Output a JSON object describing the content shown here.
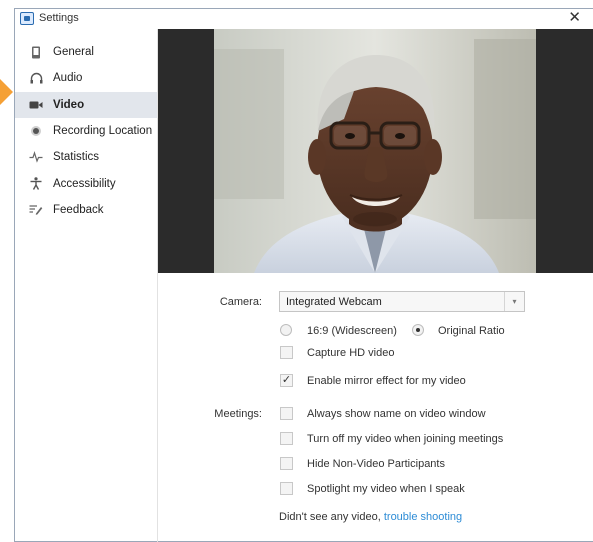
{
  "window": {
    "title": "Settings",
    "close_glyph": "✕"
  },
  "sidebar": {
    "items": [
      {
        "label": "General",
        "icon": "phone-icon"
      },
      {
        "label": "Audio",
        "icon": "headphones-icon"
      },
      {
        "label": "Video",
        "icon": "video-camera-icon",
        "active": true
      },
      {
        "label": "Recording Location",
        "icon": "record-dot-icon"
      },
      {
        "label": "Statistics",
        "icon": "statistics-icon"
      },
      {
        "label": "Accessibility",
        "icon": "accessibility-icon"
      },
      {
        "label": "Feedback",
        "icon": "feedback-icon"
      }
    ]
  },
  "video": {
    "camera_label": "Camera:",
    "camera_value": "Integrated Webcam",
    "aspect": {
      "option1": "16:9 (Widescreen)",
      "option2": "Original Ratio",
      "selected": "Original Ratio"
    },
    "hd_label": "Capture HD video",
    "hd_checked": false,
    "mirror_label": "Enable mirror effect for my video",
    "mirror_checked": true,
    "meetings_label": "Meetings:",
    "meetings_options": [
      {
        "label": "Always show name on video window",
        "checked": false
      },
      {
        "label": "Turn off my video when joining meetings",
        "checked": false
      },
      {
        "label": "Hide Non-Video Participants",
        "checked": false
      },
      {
        "label": "Spotlight my video when I speak",
        "checked": false
      }
    ],
    "help_text": "Didn't see any video,",
    "help_link": "trouble shooting"
  },
  "colors": {
    "accent_arrow": "#f5a035",
    "link": "#2d8cd6",
    "active_bg": "#e2e6ec"
  }
}
